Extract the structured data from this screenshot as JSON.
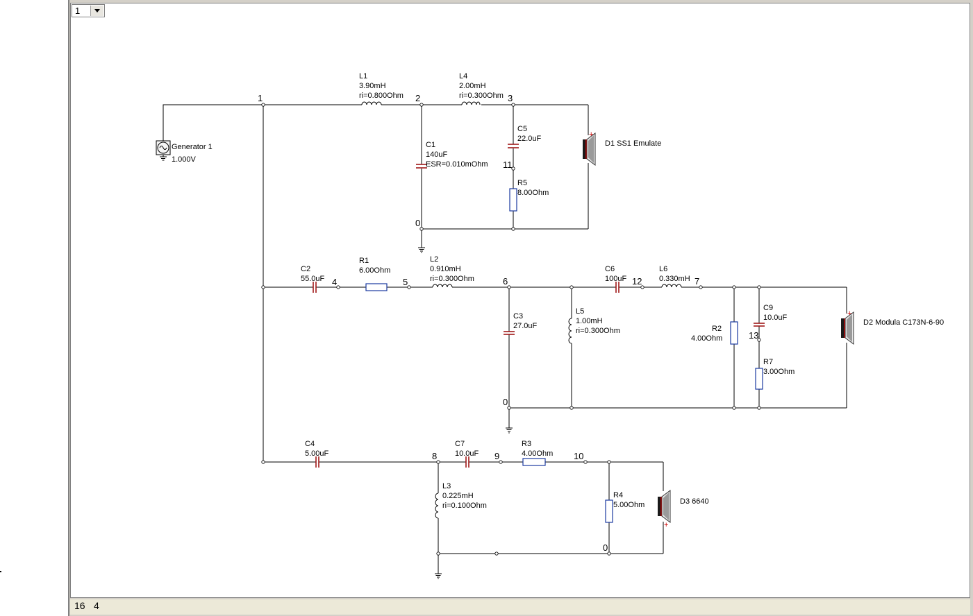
{
  "page_selector": {
    "value": "1"
  },
  "status": {
    "left": "16",
    "right": "4"
  },
  "generator": {
    "name": "Generator 1",
    "value": "1.000V"
  },
  "speakers": {
    "d1": "D1  SS1 Emulate",
    "d2": "D2 Modula C173N-6-90",
    "d3": "D3 6640"
  },
  "components": {
    "L1": {
      "name": "L1",
      "v1": "3.90mH",
      "v2": "ri=0.800Ohm"
    },
    "L4": {
      "name": "L4",
      "v1": "2.00mH",
      "v2": "ri=0.300Ohm"
    },
    "C1": {
      "name": "C1",
      "v1": "140uF",
      "v2": "ESR=0.010mOhm"
    },
    "C5": {
      "name": "C5",
      "v1": "22.0uF"
    },
    "R5": {
      "name": "R5",
      "v1": "8.00Ohm"
    },
    "C2": {
      "name": "C2",
      "v1": "55.0uF"
    },
    "R1": {
      "name": "R1",
      "v1": "6.00Ohm"
    },
    "L2": {
      "name": "L2",
      "v1": "0.910mH",
      "v2": "ri=0.300Ohm"
    },
    "C6": {
      "name": "C6",
      "v1": "100uF"
    },
    "L6": {
      "name": "L6",
      "v1": "0.330mH"
    },
    "C3": {
      "name": "C3",
      "v1": "27.0uF"
    },
    "L5": {
      "name": "L5",
      "v1": "1.00mH",
      "v2": "ri=0.300Ohm"
    },
    "R2": {
      "name": "R2",
      "v1": "4.00Ohm"
    },
    "C9": {
      "name": "C9",
      "v1": "10.0uF"
    },
    "R7": {
      "name": "R7",
      "v1": "3.00Ohm"
    },
    "C4": {
      "name": "C4",
      "v1": "5.00uF"
    },
    "C7": {
      "name": "C7",
      "v1": "10.0uF"
    },
    "R3": {
      "name": "R3",
      "v1": "4.00Ohm"
    },
    "L3": {
      "name": "L3",
      "v1": "0.225mH",
      "v2": "ri=0.100Ohm"
    },
    "R4": {
      "name": "R4",
      "v1": "5.00Ohm"
    }
  },
  "nodes": {
    "n1": "1",
    "n2": "2",
    "n3": "3",
    "n11": "11",
    "n0a": "0",
    "n4": "4",
    "n5": "5",
    "n6": "6",
    "n12": "12",
    "n7": "7",
    "n13": "13",
    "n0b": "0",
    "n8": "8",
    "n9": "9",
    "n10": "10",
    "n0c": "0"
  },
  "colors": {
    "capacitor_plate": "#a01818",
    "resistor": "#1a3aa0",
    "speaker_red": "#cc0000"
  }
}
